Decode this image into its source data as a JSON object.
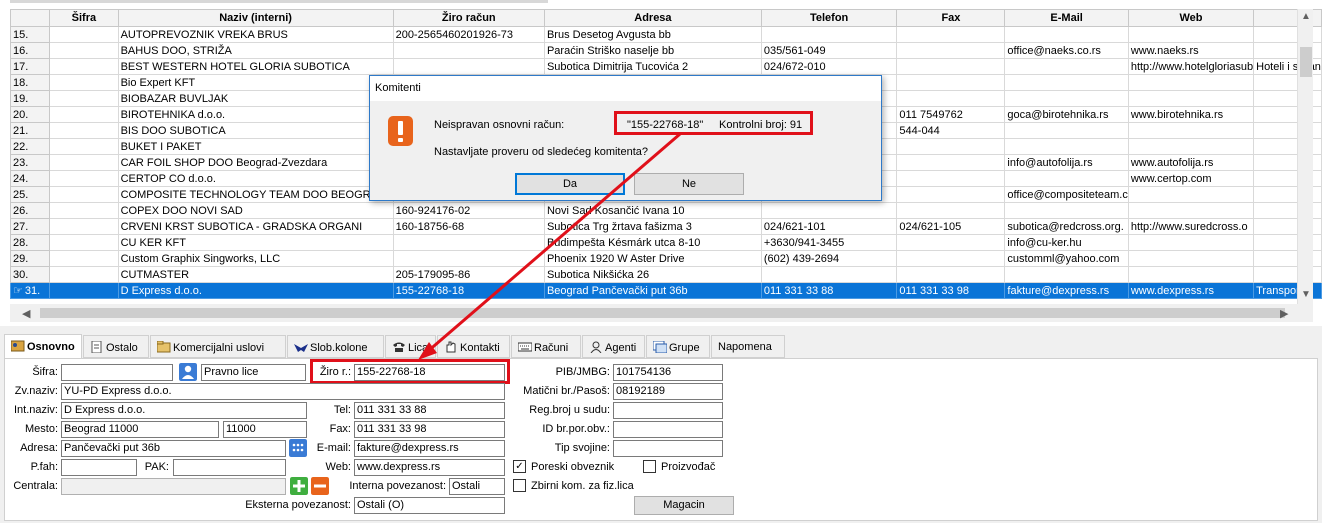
{
  "grid": {
    "columns": [
      "",
      "Šifra",
      "Naziv (interni)",
      "Žiro račun",
      "Adresa",
      "Telefon",
      "Fax",
      "E-Mail",
      "Web",
      ""
    ],
    "rows": [
      [
        "15.",
        "",
        "AUTOPREVOZNIK VREKA BRUS",
        "200-2565460201926-73",
        "Brus Desetog Avgusta bb",
        "",
        "",
        "",
        "",
        ""
      ],
      [
        "16.",
        "",
        "BAHUS DOO, STRIŽA",
        "",
        "Paraćin Striško naselje bb",
        "035/561-049",
        "",
        "office@naeks.co.rs",
        "www.naeks.rs",
        ""
      ],
      [
        "17.",
        "",
        "BEST WESTERN HOTEL GLORIA SUBOTICA",
        "",
        "Subotica Dimitrija Tucovića 2",
        "024/672-010",
        "",
        "",
        "http://www.hotelgloriasub",
        "Hoteli i sličan"
      ],
      [
        "18.",
        "",
        "Bio Expert KFT",
        "",
        "",
        "",
        "",
        "",
        "",
        ""
      ],
      [
        "19.",
        "",
        "BIOBAZAR BUVLJAK",
        "",
        "",
        "",
        "",
        "",
        "",
        ""
      ],
      [
        "20.",
        "",
        "BIROTEHNIKA d.o.o.",
        "",
        "",
        "",
        "011 7549762",
        "goca@birotehnika.rs",
        "www.birotehnika.rs",
        ""
      ],
      [
        "21.",
        "",
        "BIS DOO SUBOTICA",
        "",
        "",
        "",
        "544-044",
        "",
        "",
        ""
      ],
      [
        "22.",
        "",
        "BUKET I PAKET",
        "",
        "",
        "",
        "",
        "",
        "",
        ""
      ],
      [
        "23.",
        "",
        "CAR FOIL SHOP DOO Beograd-Zvezdara",
        "",
        "",
        "",
        "",
        "info@autofolija.rs",
        "www.autofolija.rs",
        ""
      ],
      [
        "24.",
        "",
        "CERTOP CO d.o.o.",
        "",
        "",
        "",
        "",
        "",
        "www.certop.com",
        ""
      ],
      [
        "25.",
        "",
        "COMPOSITE TECHNOLOGY TEAM DOO BEOGRAD (",
        "",
        "",
        "",
        "",
        "office@compositeteam.c",
        "",
        ""
      ],
      [
        "26.",
        "",
        "COPEX DOO NOVI SAD",
        "160-924176-02",
        "Novi Sad Kosančić Ivana 10",
        "",
        "",
        "",
        "",
        ""
      ],
      [
        "27.",
        "",
        "CRVENI KRST SUBOTICA  -  GRADSKA  ORGANI",
        "160-18756-68",
        "Subotica Trg žrtava fašizma 3",
        "024/621-101",
        "024/621-105",
        "subotica@redcross.org.",
        "http://www.suredcross.o",
        ""
      ],
      [
        "28.",
        "",
        "CU KER KFT",
        "",
        "Budimpešta Késmárk utca 8-10",
        "+3630/941-3455",
        "",
        "info@cu-ker.hu",
        "",
        ""
      ],
      [
        "29.",
        "",
        "Custom Graphix Singworks, LLC",
        "",
        "Phoenix 1920 W Aster Drive",
        "(602) 439-2694",
        "",
        "customml@yahoo.com",
        "",
        ""
      ],
      [
        "30.",
        "",
        "CUTMASTER",
        "205-179095-86",
        "Subotica Nikšićka 26",
        "",
        "",
        "",
        "",
        ""
      ],
      [
        "31.",
        "",
        "D Express d.o.o.",
        "155-22768-18",
        "Beograd Pančevački put 36b",
        "011 331 33 88",
        "011 331 33 98",
        "fakture@dexpress.rs",
        "www.dexpress.rs",
        "Transport"
      ]
    ]
  },
  "dialog": {
    "title": "Komitenti",
    "message_label": "Neispravan osnovni račun:",
    "account_value": "\"155-22768-18\"",
    "control_label": "Kontrolni broj: 91",
    "question": "Nastavljate proveru od sledećeg komitenta?",
    "yes_label": "Da",
    "no_label": "Ne"
  },
  "tabs": [
    {
      "label": "Osnovno",
      "icon": "card-icon"
    },
    {
      "label": "Ostalo",
      "icon": "document-icon"
    },
    {
      "label": "Komercijalni uslovi",
      "icon": "folder-icon"
    },
    {
      "label": "Slob.kolone",
      "icon": "bird-icon"
    },
    {
      "label": "Lica",
      "icon": "phone-icon"
    },
    {
      "label": "Kontakti",
      "icon": "hand-icon"
    },
    {
      "label": "Računi",
      "icon": "keyboard-icon"
    },
    {
      "label": "Agenti",
      "icon": "agent-icon"
    },
    {
      "label": "Grupe",
      "icon": "window-icon"
    },
    {
      "label": "Napomena",
      "icon": ""
    }
  ],
  "form": {
    "sifra_label": "Šifra:",
    "sifra_value": "",
    "tip_value": "Pravno lice",
    "ziro_label": "Žiro r.:",
    "ziro_value": "155-22768-18",
    "pib_label": "PIB/JMBG:",
    "pib_value": "101754136",
    "zvnaziv_label": "Zv.naziv:",
    "zvnaziv_value": "YU-PD Express d.o.o.",
    "maticni_label": "Matični br./Pasoš:",
    "maticni_value": "08192189",
    "intnaziv_label": "Int.naziv:",
    "intnaziv_value": "D Express d.o.o.",
    "tel_label": "Tel:",
    "tel_value": "011 331 33 88",
    "regbroj_label": "Reg.broj u sudu:",
    "regbroj_value": "",
    "mesto_label": "Mesto:",
    "mesto_value": "Beograd  11000",
    "ptt_value": "11000",
    "fax_label": "Fax:",
    "fax_value": "011 331 33 98",
    "idpor_label": "ID br.por.obv.:",
    "idpor_value": "",
    "adresa_label": "Adresa:",
    "adresa_value": "Pančevački put 36b",
    "email_label": "E-mail:",
    "email_value": "fakture@dexpress.rs",
    "tipsvojine_label": "Tip svojine:",
    "tipsvojine_value": "",
    "pfah_label": "P.fah:",
    "pfah_value": "",
    "pak_label": "PAK:",
    "pak_value": "",
    "web_label": "Web:",
    "web_value": "www.dexpress.rs",
    "poreski_label": "Poreski obveznik",
    "proizvodjac_label": "Proizvođač",
    "centrala_label": "Centrala:",
    "centrala_value": "",
    "interna_label": "Interna povezanost:",
    "interna_value": "Ostali",
    "zbirni_label": "Zbirni kom. za fiz.lica",
    "eksterna_label": "Eksterna povezanost:",
    "eksterna_value": "Ostali (O)",
    "magacin_label": "Magacin"
  },
  "colors": {
    "selection": "#0a74d7",
    "highlight": "#e0101a",
    "warning": "#e8641c"
  }
}
